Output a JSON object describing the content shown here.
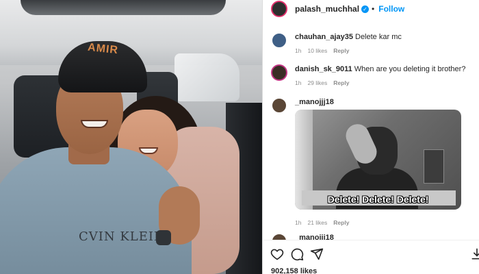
{
  "post_image": {
    "cap_text": "AMIR",
    "shirt_print": "CVIN KLEIN"
  },
  "header": {
    "username": "palash_muchhal",
    "separator": "•",
    "follow_label": "Follow"
  },
  "comments": [
    {
      "user": "chauhan_ajay35",
      "text": "Delete kar mc",
      "time": "1h",
      "likes": "10 likes",
      "reply": "Reply"
    },
    {
      "user": "danish_sk_9011",
      "text": "When are you deleting it brother?",
      "time": "1h",
      "likes": "29 likes",
      "reply": "Reply"
    },
    {
      "user": "_manojjj18",
      "text": "",
      "time": "1h",
      "likes": "21 likes",
      "reply": "Reply",
      "gif_caption": "Delete! Delete! Delete!"
    },
    {
      "user": "_manojjj18",
      "text": ""
    }
  ],
  "actions": {
    "icons": [
      "heart-icon",
      "comment-icon",
      "share-icon",
      "save-icon"
    ],
    "like_count": "902,158 likes"
  },
  "colors": {
    "accent": "#0095f6",
    "story_ring": "#e1306c",
    "meta_text": "#8e8e8e"
  }
}
